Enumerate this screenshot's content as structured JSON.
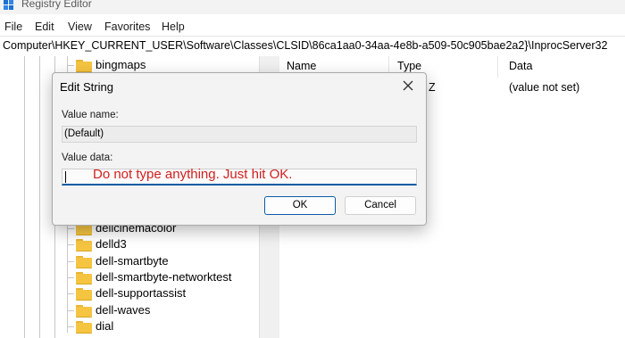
{
  "window": {
    "title": "Registry Editor"
  },
  "menu": [
    "File",
    "Edit",
    "View",
    "Favorites",
    "Help"
  ],
  "address": "Computer\\HKEY_CURRENT_USER\\Software\\Classes\\CLSID\\86ca1aa0-34aa-4e8b-a509-50c905bae2a2}\\InprocServer32",
  "tree": {
    "items": [
      "bingmaps",
      "dellcinemacolor",
      "delld3",
      "dell-smartbyte",
      "dell-smartbyte-networktest",
      "dell-supportassist",
      "dell-waves",
      "dial"
    ]
  },
  "list": {
    "columns": [
      "Name",
      "Type",
      "Data"
    ],
    "row": {
      "type_partial": "Z",
      "data": "(value not set)"
    }
  },
  "dialog": {
    "title": "Edit String",
    "value_name_label": "Value name:",
    "value_name": "(Default)",
    "value_data_label": "Value data:",
    "annotation": "Do not type anything. Just hit OK.",
    "ok_label": "OK",
    "cancel_label": "Cancel"
  }
}
